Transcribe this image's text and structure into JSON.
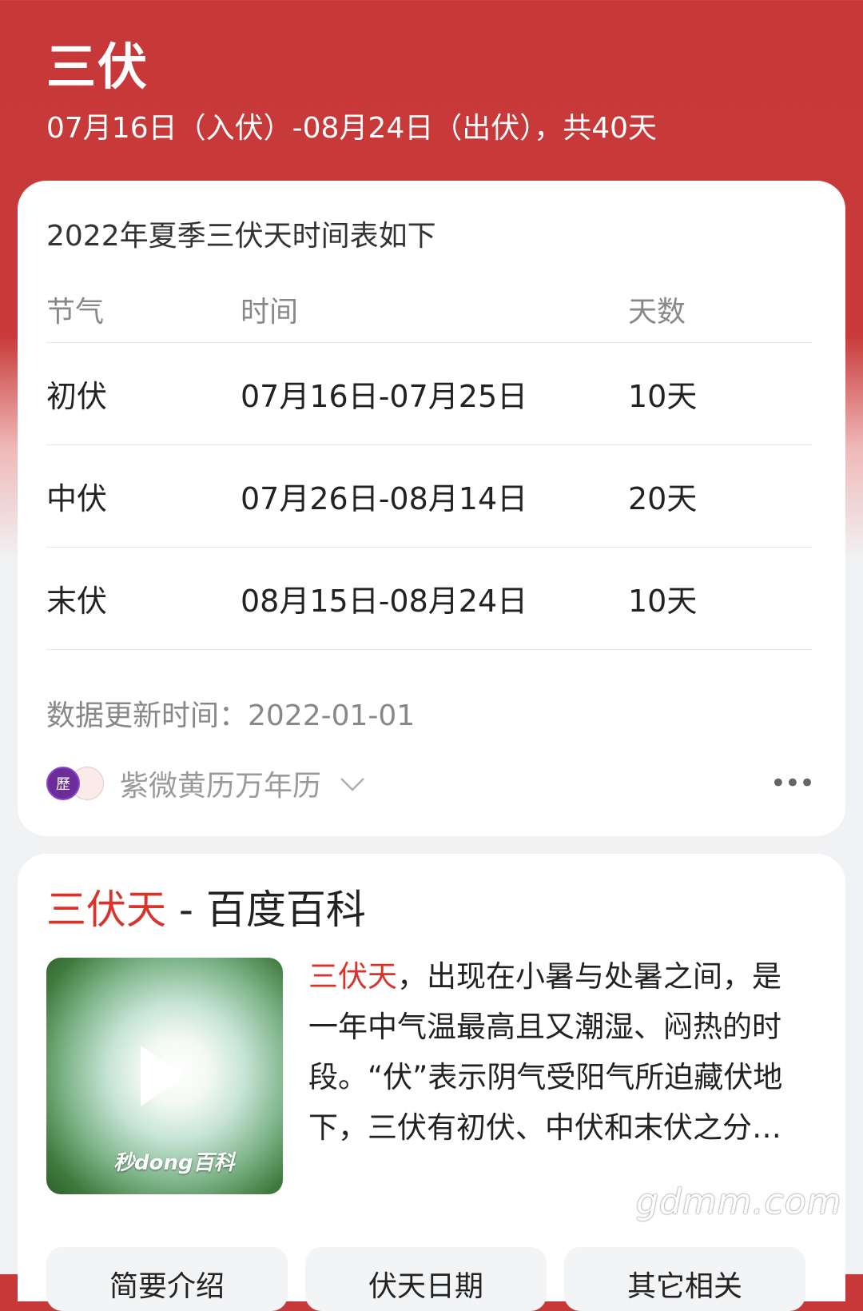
{
  "header": {
    "title": "三伏",
    "subtitle": "07月16日（入伏）-08月24日（出伏），共40天"
  },
  "schedule_card": {
    "heading": "2022年夏季三伏天时间表如下",
    "columns": [
      "节气",
      "时间",
      "天数"
    ],
    "rows": [
      {
        "term": "初伏",
        "dates": "07月16日-07月25日",
        "days": "10天"
      },
      {
        "term": "中伏",
        "dates": "07月26日-08月14日",
        "days": "20天"
      },
      {
        "term": "末伏",
        "dates": "08月15日-08月24日",
        "days": "10天"
      }
    ],
    "updated": "数据更新时间：2022-01-01",
    "source": {
      "name": "紫微黄历万年历",
      "logo_char": "歷"
    },
    "more_label": "•••"
  },
  "baike_card": {
    "title_highlight": "三伏天",
    "title_rest": " - 百度百科",
    "video_brand": "秒dong百科",
    "description_highlight": "三伏天",
    "description_rest": "，出现在小暑与处暑之间，是一年中气温最高且又潮湿、闷热的时段。“伏”表示阴气受阳气所迫藏伏地下，三伏有初伏、中伏和末伏之分…",
    "chips": [
      "简要介绍",
      "伏天日期",
      "其它相关"
    ]
  },
  "watermark": "gdmm.com",
  "colors": {
    "header_red": "#c73838",
    "highlight_red": "#d9342b",
    "logo_purple": "#6a2d9a"
  }
}
